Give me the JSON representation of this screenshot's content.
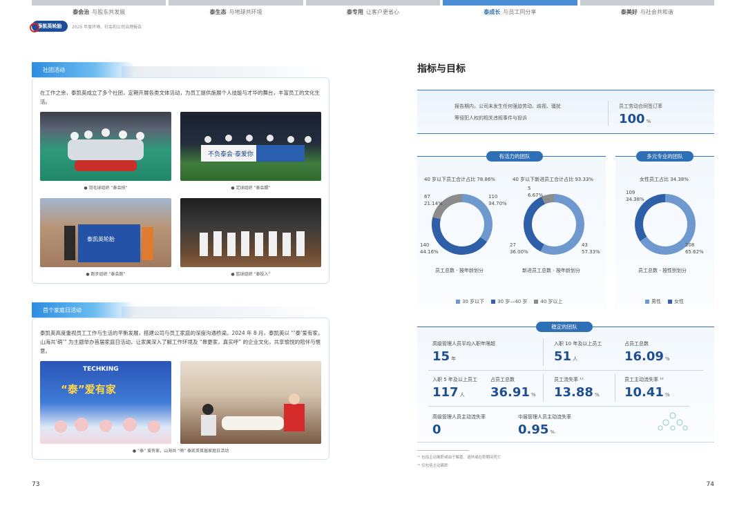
{
  "nav": [
    {
      "title": "泰会治",
      "sub": "与股东共发展",
      "active": false
    },
    {
      "title": "泰生态",
      "sub": "与地球共环境",
      "active": false
    },
    {
      "title": "泰专用",
      "sub": "让客户更省心",
      "active": false
    },
    {
      "title": "泰成长",
      "sub": "与员工同分享",
      "active": true
    },
    {
      "title": "泰美好",
      "sub": "与社会共和谐",
      "active": false
    }
  ],
  "logo": {
    "name": "泰凯英轮胎",
    "sub": "2025 年度环境、社会和公司治理报告"
  },
  "left": {
    "sec1": {
      "tab": "社团活动",
      "text": "在工作之余，泰凯英成立了多个社团，定期开展各类文体活动，为员工提供施展个人技能与才华的舞台，丰富员工的文化生活。",
      "captions": [
        "● 羽毛球组织 “泰会拍”",
        "● 足球组织 “泰会踢”",
        "● 跑步组织 “泰会跑”",
        "● 篮球组织 “泰投入”"
      ],
      "banner1": "不负泰会·泰爱你",
      "banner2": "泰凯英轮胎"
    },
    "sec2": {
      "tab": "首个家庭日活动",
      "text": "泰凯英高度重视员工工作与生活的平衡发展，搭建公司与员工家庭的深度沟通桥梁。2024 年 8 月，泰凯英以 “‘泰’爱有家，山海共‘萌’” 为主题举办首届家庭日活动，让家属深入了解工作环境及 “靠更家，真实呼” 的企业文化，共享愉悦的陪伴与惬意。",
      "caption": "● “泰” 爱有家，山海共 “萌” 泰凯英首届家庭日活动",
      "brand": "TECHKING",
      "slogan": "“泰”爱有家"
    },
    "page": "73"
  },
  "right": {
    "title": "指标与目标",
    "top": {
      "text1": "报告期内，公司未发生任何强迫劳动、歧视、骚扰",
      "text2": "等侵犯人权的相关违规事件与投诉",
      "label": "员工劳动合同签订率",
      "value": "100",
      "unit": "%"
    },
    "team1": {
      "pill": "有活力的团队",
      "c1": {
        "title": "40 岁以下员工合计占比 78.86%",
        "caption": "员工总数 - 按年龄划分",
        "a": "67",
        "ap": "21.14%",
        "b": "110",
        "bp": "34.70%",
        "c": "140",
        "cp": "44.16%"
      },
      "c2": {
        "title": "40 岁以下新进员工合计占比 93.33%",
        "caption": "新进员工总数 - 按年龄划分",
        "a": "5",
        "ap": "6.67%",
        "b": "27",
        "bp": "36.00%",
        "c": "43",
        "cp": "57.33%"
      },
      "legend": [
        "30 岁以下",
        "30 岁—40 岁",
        "40 岁以上"
      ]
    },
    "team2": {
      "pill": "多元专业的团队",
      "c3": {
        "title": "女性员工占比 34.38%",
        "caption": "员工总数 - 按性别划分",
        "a": "109",
        "ap": "34.38%",
        "b": "208",
        "bp": "65.62%"
      },
      "legend": [
        "男性",
        "女性"
      ]
    },
    "team3": {
      "pill": "稳定的团队",
      "m": [
        {
          "label": "高级管理人员平均入职年限超",
          "value": "15",
          "unit": "年"
        },
        {
          "label": "入职 10 年及以上员工",
          "value": "51",
          "unit": "人"
        },
        {
          "label": "占员工总数",
          "value": "16.09",
          "unit": "%"
        },
        {
          "label": "入职 5 年及以上员工",
          "value": "117",
          "unit": "人"
        },
        {
          "label": "占员工总数",
          "value": "36.91",
          "unit": "%"
        },
        {
          "label": "员工流失率 ¹¹",
          "value": "13.88",
          "unit": "%"
        },
        {
          "label": "员工主动流失率 ¹²",
          "value": "10.41",
          "unit": "%"
        },
        {
          "label": "高级管理人员主动流失率",
          "value": "0",
          "unit": ""
        },
        {
          "label": "中层管理人员主动流失率",
          "value": "0.95",
          "unit": "%"
        }
      ]
    },
    "notes": [
      "¹¹ 包括主动离职或由于解雇、退休或在职期间死亡",
      "¹² 仅包括主动离职"
    ],
    "page": "74"
  },
  "colors": {
    "dark": "#2f5fa7",
    "mid": "#6f98cf",
    "grey": "#8c8c8c"
  }
}
